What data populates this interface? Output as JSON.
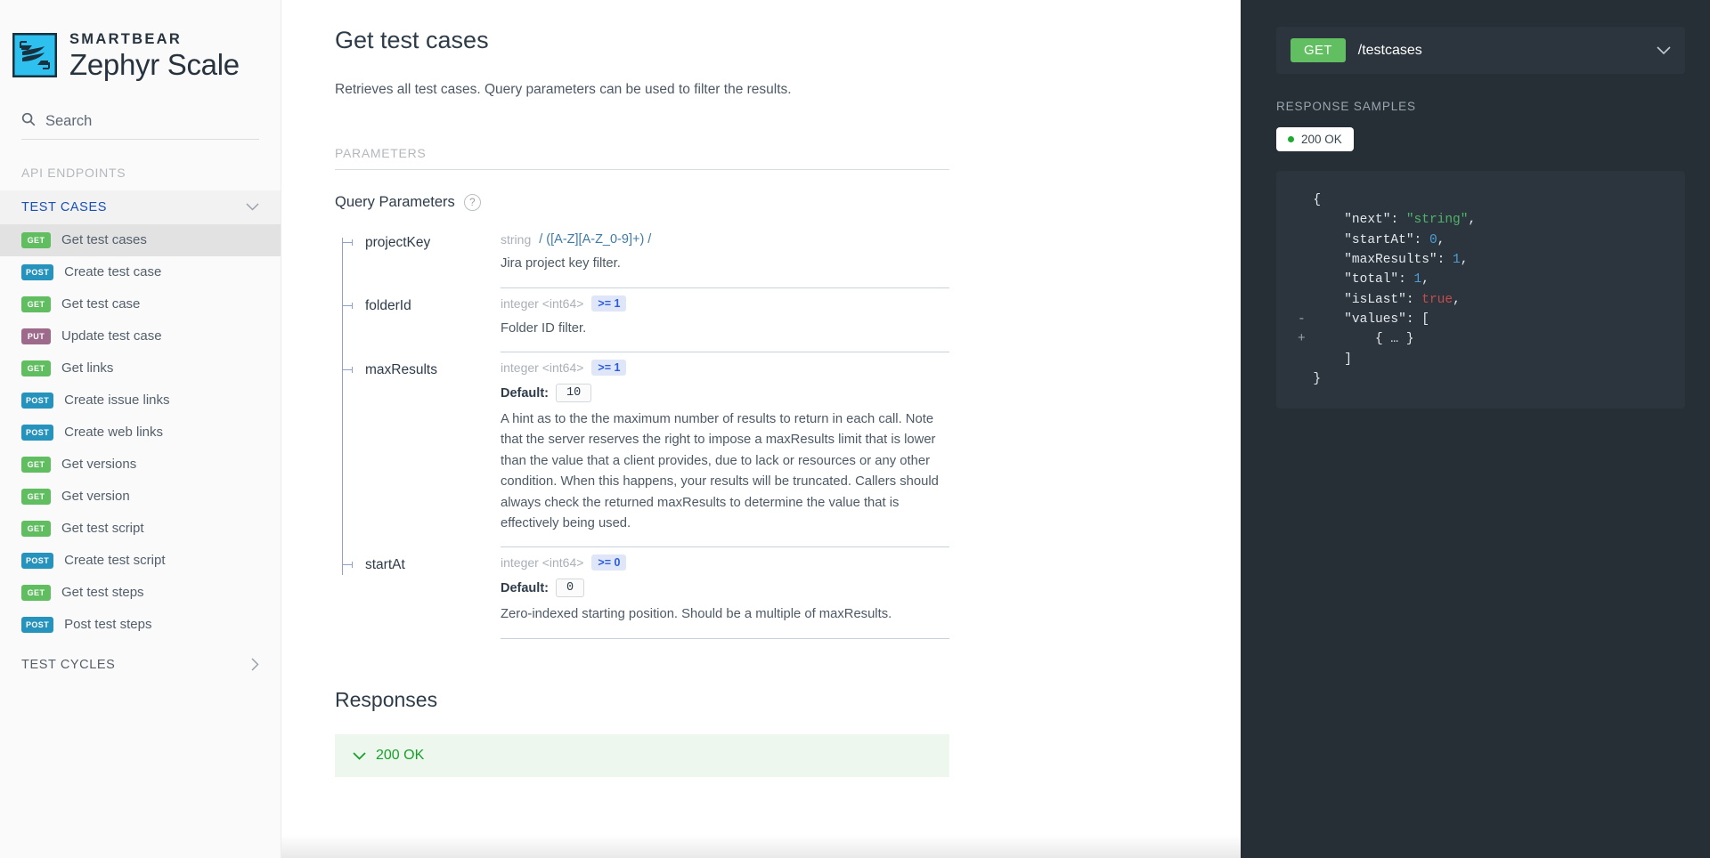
{
  "brand": {
    "top": "SMARTBEAR",
    "main": "Zephyr Scale",
    "logo_bg": "#2ec0ee",
    "logo_fg": "#17313f"
  },
  "search": {
    "placeholder": "Search",
    "value": "",
    "icon": "search-icon"
  },
  "sidebar": {
    "section_label": "API ENDPOINTS",
    "groups": [
      {
        "title": "TEST CASES",
        "expanded": true,
        "chevron": "chevron-down-icon",
        "items": [
          {
            "method": "GET",
            "label": "Get test cases",
            "active": true
          },
          {
            "method": "POST",
            "label": "Create test case",
            "active": false
          },
          {
            "method": "GET",
            "label": "Get test case",
            "active": false
          },
          {
            "method": "PUT",
            "label": "Update test case",
            "active": false
          },
          {
            "method": "GET",
            "label": "Get links",
            "active": false
          },
          {
            "method": "POST",
            "label": "Create issue links",
            "active": false
          },
          {
            "method": "POST",
            "label": "Create web links",
            "active": false
          },
          {
            "method": "GET",
            "label": "Get versions",
            "active": false
          },
          {
            "method": "GET",
            "label": "Get version",
            "active": false
          },
          {
            "method": "GET",
            "label": "Get test script",
            "active": false
          },
          {
            "method": "POST",
            "label": "Create test script",
            "active": false
          },
          {
            "method": "GET",
            "label": "Get test steps",
            "active": false
          },
          {
            "method": "POST",
            "label": "Post test steps",
            "active": false
          }
        ]
      },
      {
        "title": "TEST CYCLES",
        "expanded": false,
        "chevron": "chevron-right-icon",
        "items": []
      }
    ],
    "method_colors": {
      "GET": "#60be61",
      "POST": "#2693bd",
      "PUT": "#9e6a8c"
    }
  },
  "main": {
    "title": "Get test cases",
    "description": "Retrieves all test cases. Query parameters can be used to filter the results.",
    "parameters_label": "PARAMETERS",
    "query_params_title": "Query Parameters",
    "help_icon": "question-mark-icon",
    "params": [
      {
        "name": "projectKey",
        "type": "string",
        "pattern": "/ ([A-Z][A-Z_0-9]+) /",
        "constraint": "",
        "default_label": "",
        "default_value": "",
        "description": "Jira project key filter."
      },
      {
        "name": "folderId",
        "type": "integer <int64>",
        "pattern": "",
        "constraint": ">= 1",
        "default_label": "",
        "default_value": "",
        "description": "Folder ID filter."
      },
      {
        "name": "maxResults",
        "type": "integer <int64>",
        "pattern": "",
        "constraint": ">= 1",
        "default_label": "Default:",
        "default_value": "10",
        "description": "A hint as to the the maximum number of results to return in each call. Note that the server reserves the right to impose a maxResults limit that is lower than the value that a client provides, due to lack or resources or any other condition. When this happens, your results will be truncated. Callers should always check the returned maxResults to determine the value that is effectively being used."
      },
      {
        "name": "startAt",
        "type": "integer <int64>",
        "pattern": "",
        "constraint": ">= 0",
        "default_label": "Default:",
        "default_value": "0",
        "description": "Zero-indexed starting position. Should be a multiple of maxResults."
      }
    ],
    "responses_title": "Responses",
    "response_items": [
      {
        "code": "200 OK",
        "chevron": "chevron-down-icon"
      }
    ]
  },
  "rightpanel": {
    "method": "GET",
    "path": "/testcases",
    "bar_chevron": "chevron-down-icon",
    "response_samples_label": "RESPONSE SAMPLES",
    "status_pill": "200 OK",
    "status_color": "#1fa92f",
    "code_lines": [
      {
        "indent": 0,
        "fold": "",
        "parts": [
          {
            "t": "punct",
            "v": "{"
          }
        ]
      },
      {
        "indent": 1,
        "fold": "",
        "parts": [
          {
            "t": "key",
            "v": "\"next\""
          },
          {
            "t": "punct",
            "v": ": "
          },
          {
            "t": "str",
            "v": "\"string\""
          },
          {
            "t": "punct",
            "v": ","
          }
        ]
      },
      {
        "indent": 1,
        "fold": "",
        "parts": [
          {
            "t": "key",
            "v": "\"startAt\""
          },
          {
            "t": "punct",
            "v": ": "
          },
          {
            "t": "num",
            "v": "0"
          },
          {
            "t": "punct",
            "v": ","
          }
        ]
      },
      {
        "indent": 1,
        "fold": "",
        "parts": [
          {
            "t": "key",
            "v": "\"maxResults\""
          },
          {
            "t": "punct",
            "v": ": "
          },
          {
            "t": "num",
            "v": "1"
          },
          {
            "t": "punct",
            "v": ","
          }
        ]
      },
      {
        "indent": 1,
        "fold": "",
        "parts": [
          {
            "t": "key",
            "v": "\"total\""
          },
          {
            "t": "punct",
            "v": ": "
          },
          {
            "t": "num",
            "v": "1"
          },
          {
            "t": "punct",
            "v": ","
          }
        ]
      },
      {
        "indent": 1,
        "fold": "",
        "parts": [
          {
            "t": "key",
            "v": "\"isLast\""
          },
          {
            "t": "punct",
            "v": ": "
          },
          {
            "t": "bool",
            "v": "true"
          },
          {
            "t": "punct",
            "v": ","
          }
        ]
      },
      {
        "indent": 1,
        "fold": "-",
        "parts": [
          {
            "t": "key",
            "v": "\"values\""
          },
          {
            "t": "punct",
            "v": ": ["
          }
        ]
      },
      {
        "indent": 2,
        "fold": "+",
        "parts": [
          {
            "t": "punct",
            "v": "{ … }"
          }
        ]
      },
      {
        "indent": 1,
        "fold": "",
        "parts": [
          {
            "t": "punct",
            "v": "]"
          }
        ]
      },
      {
        "indent": 0,
        "fold": "",
        "parts": [
          {
            "t": "punct",
            "v": "}"
          }
        ]
      }
    ]
  }
}
